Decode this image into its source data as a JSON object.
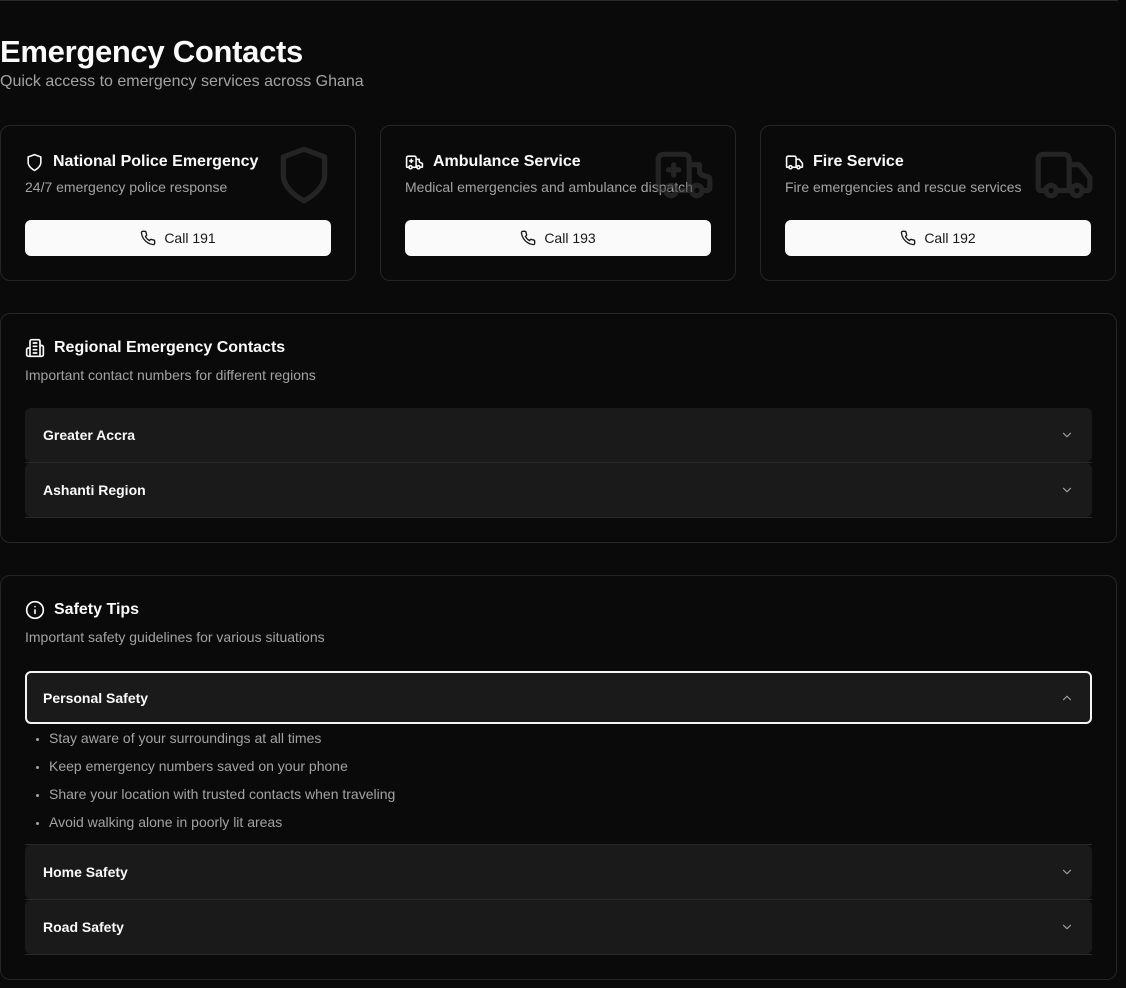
{
  "page": {
    "title": "Emergency Contacts",
    "subtitle": "Quick access to emergency services across Ghana"
  },
  "services": [
    {
      "title": "National Police Emergency",
      "description": "24/7 emergency police response",
      "button_label": "Call 191",
      "icon": "shield-icon"
    },
    {
      "title": "Ambulance Service",
      "description": "Medical emergencies and ambulance dispatch",
      "button_label": "Call 193",
      "icon": "ambulance-icon"
    },
    {
      "title": "Fire Service",
      "description": "Fire emergencies and rescue services",
      "button_label": "Call 192",
      "icon": "truck-icon"
    }
  ],
  "regional": {
    "title": "Regional Emergency Contacts",
    "description": "Important contact numbers for different regions",
    "icon": "building-icon",
    "items": [
      {
        "label": "Greater Accra",
        "expanded": false
      },
      {
        "label": "Ashanti Region",
        "expanded": false
      }
    ]
  },
  "safety": {
    "title": "Safety Tips",
    "description": "Important safety guidelines for various situations",
    "icon": "info-icon",
    "items": [
      {
        "label": "Personal Safety",
        "expanded": true,
        "tips": [
          "Stay aware of your surroundings at all times",
          "Keep emergency numbers saved on your phone",
          "Share your location with trusted contacts when traveling",
          "Avoid walking alone in poorly lit areas"
        ]
      },
      {
        "label": "Home Safety",
        "expanded": false
      },
      {
        "label": "Road Safety",
        "expanded": false
      }
    ]
  },
  "colors": {
    "background": "#0a0a0a",
    "card_border": "#262626",
    "accordion_bg": "#1a1a1a",
    "muted_text": "#a3a3a3",
    "button_bg": "#fafafa"
  }
}
